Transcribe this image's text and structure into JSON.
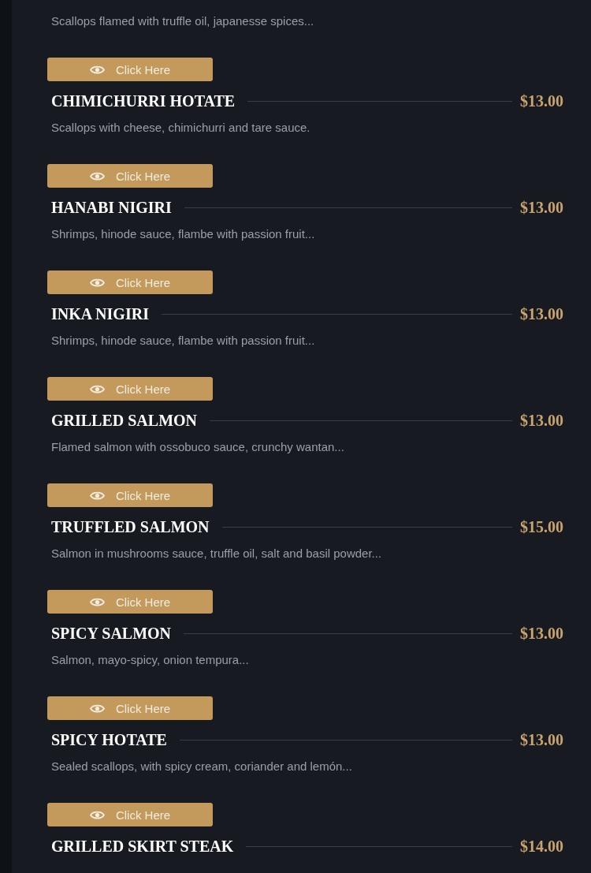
{
  "top_item": {
    "description": "Scallops flamed with truffle oil, japanesse spices..."
  },
  "items": [
    {
      "button": "Click Here",
      "name": "CHIMICHURRI HOTATE",
      "price": "$13.00",
      "description": "Scallops with cheese, chimichurri and tare sauce."
    },
    {
      "button": "Click Here",
      "name": "HANABI NIGIRI",
      "price": "$13.00",
      "description": "Shrimps, hinode sauce, flambe with passion fruit..."
    },
    {
      "button": "Click Here",
      "name": "INKA NIGIRI",
      "price": "$13.00",
      "description": "Shrimps, hinode sauce, flambe with passion fruit..."
    },
    {
      "button": "Click Here",
      "name": "GRILLED SALMON",
      "price": "$13.00",
      "description": "Flamed salmon with ossobuco sauce, crunchy wantan..."
    },
    {
      "button": "Click Here",
      "name": "TRUFFLED SALMON",
      "price": "$15.00",
      "description": "Salmon in mushrooms sauce, truffle oil, salt and basil powder..."
    },
    {
      "button": "Click Here",
      "name": "SPICY SALMON",
      "price": "$13.00",
      "description": "Salmon, mayo-spicy, onion tempura..."
    },
    {
      "button": "Click Here",
      "name": "SPICY HOTATE",
      "price": "$13.00",
      "description": "Sealed scallops, with spicy cream, coriander and lemón..."
    },
    {
      "button": "Click Here",
      "name": "GRILLED SKIRT STEAK",
      "price": "$14.00"
    }
  ]
}
